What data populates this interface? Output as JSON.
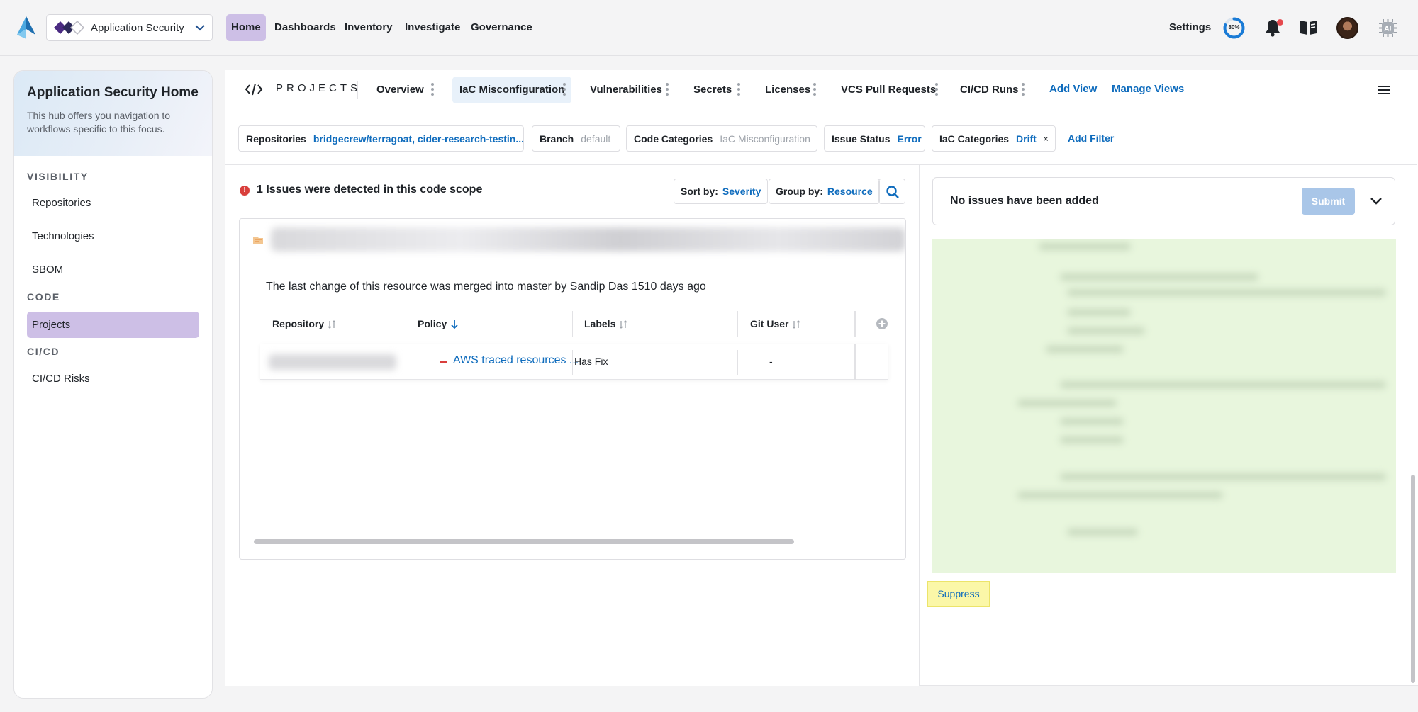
{
  "header": {
    "app_switcher": {
      "label": "Application Security",
      "icon": "prisma-cloud-logo"
    },
    "nav": [
      "Home",
      "Dashboards",
      "Inventory",
      "Investigate",
      "Governance"
    ],
    "settings_label": "Settings",
    "progress_text": "80%",
    "progress_value": 0.8,
    "icons": [
      "bell-icon",
      "docs-book-icon",
      "user-avatar",
      "ai-icon"
    ]
  },
  "sidebar": {
    "title": "Application Security Home",
    "description": "This hub offers you navigation to workflows specific to this focus.",
    "sections": [
      {
        "label": "VISIBILITY",
        "items": [
          "Repositories",
          "Technologies",
          "SBOM"
        ]
      },
      {
        "label": "CODE",
        "items": [
          "Projects"
        ]
      },
      {
        "label": "CI/CD",
        "items": [
          "CI/CD Risks"
        ]
      }
    ],
    "active_item": "Projects"
  },
  "main": {
    "title": "PROJECTS",
    "tabs": [
      "Overview",
      "IaC Misconfiguration",
      "Vulnerabilities",
      "Secrets",
      "Licenses",
      "VCS Pull Requests",
      "CI/CD Runs"
    ],
    "active_tab": "IaC Misconfiguration",
    "add_view": "Add View",
    "manage_views": "Manage Views",
    "filters": [
      {
        "key": "Repositories",
        "value": "bridgecrew/terragoat, cider-research-testin..."
      },
      {
        "key": "Branch",
        "value": "default"
      },
      {
        "key": "Code Categories",
        "value": "IaC Misconfiguration"
      },
      {
        "key": "Issue Status",
        "value": "Error"
      },
      {
        "key": "IaC Categories",
        "value": "Drift"
      }
    ],
    "add_filter": "Add Filter",
    "issues_title": "1 Issues were detected in this code scope",
    "sort_by": {
      "key": "Sort by:",
      "value": "Severity"
    },
    "group_by": {
      "key": "Group by:",
      "value": "Resource"
    },
    "merge_text": "The last change of this resource was merged into master by Sandip Das 1510 days ago",
    "table": {
      "columns": [
        "Repository",
        "Policy",
        "Labels",
        "Git User"
      ],
      "rows": [
        {
          "policy": "AWS traced resources ...",
          "labels": "Has Fix",
          "git_user": "-"
        }
      ]
    }
  },
  "right_panel": {
    "issues_added": "No issues have been added",
    "submit": "Submit",
    "suppress": "Suppress"
  }
}
